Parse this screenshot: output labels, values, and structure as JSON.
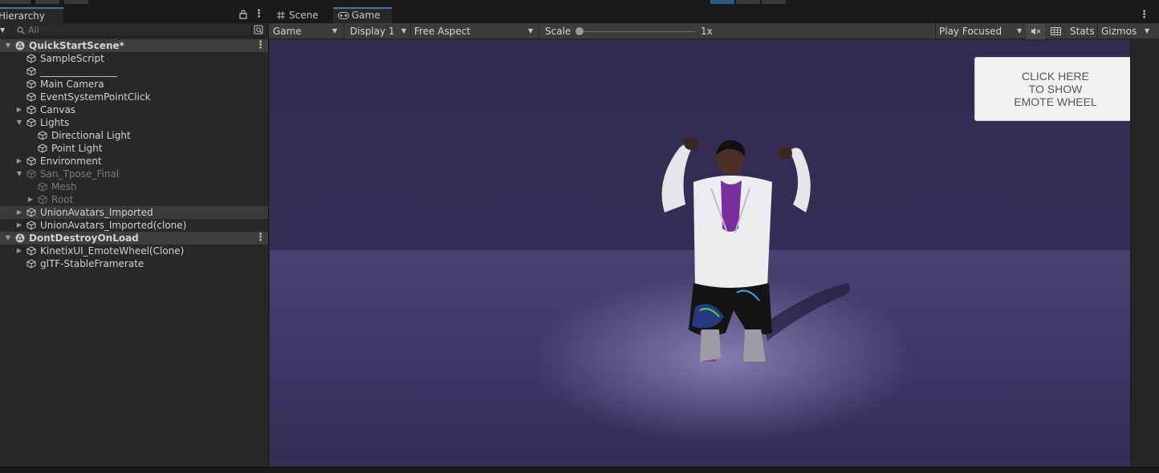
{
  "hierarchy": {
    "tab_label": "Hierarchy",
    "search_placeholder": "All",
    "items": [
      {
        "label": "QuickStartScene*",
        "type": "scene",
        "depth": 0,
        "expanded": true
      },
      {
        "label": "SampleScript",
        "type": "object",
        "depth": 1
      },
      {
        "label": "________________",
        "type": "object",
        "depth": 1
      },
      {
        "label": "Main Camera",
        "type": "object",
        "depth": 1
      },
      {
        "label": "EventSystemPointClick",
        "type": "object",
        "depth": 1
      },
      {
        "label": "Canvas",
        "type": "object",
        "depth": 1,
        "collapsed": true
      },
      {
        "label": "Lights",
        "type": "object",
        "depth": 1,
        "expanded": true
      },
      {
        "label": "Directional Light",
        "type": "object",
        "depth": 2
      },
      {
        "label": "Point Light",
        "type": "object",
        "depth": 2
      },
      {
        "label": "Environment",
        "type": "object",
        "depth": 1,
        "collapsed": true
      },
      {
        "label": "San_Tpose_Final",
        "type": "object",
        "depth": 1,
        "expanded": true,
        "inactive": true
      },
      {
        "label": "Mesh",
        "type": "object",
        "depth": 2,
        "inactive": true
      },
      {
        "label": "Root",
        "type": "object",
        "depth": 2,
        "collapsed": true,
        "inactive": true
      },
      {
        "label": "UnionAvatars_Imported",
        "type": "object",
        "depth": 1,
        "collapsed": true,
        "highlighted": true
      },
      {
        "label": "UnionAvatars_Imported(clone)",
        "type": "object",
        "depth": 1,
        "collapsed": true
      },
      {
        "label": "DontDestroyOnLoad",
        "type": "scene",
        "depth": 0,
        "expanded": true
      },
      {
        "label": "KinetixUI_EmoteWheel(Clone)",
        "type": "object",
        "depth": 1,
        "collapsed": true
      },
      {
        "label": "glTF-StableFramerate",
        "type": "object",
        "depth": 1
      }
    ]
  },
  "game_view": {
    "tabs": [
      {
        "label": "Scene",
        "icon": "grid-icon",
        "active": false
      },
      {
        "label": "Game",
        "icon": "gamepad-icon",
        "active": true
      }
    ],
    "toolbar": {
      "view_mode": "Game",
      "display": "Display 1",
      "aspect": "Free Aspect",
      "scale_label": "Scale",
      "scale_value": "1x",
      "scale_level": 0,
      "play_mode": "Play Focused",
      "stats_label": "Stats",
      "gizmos_label": "Gizmos"
    },
    "emote_button_text": "CLICK HERE\nTO SHOW\nEMOTE WHEEL"
  },
  "colors": {
    "panel_bg": "#282828",
    "tab_accent": "#3a79bb",
    "scene_row_bg": "#3e3e3e",
    "viewport_bg": "#3a325e",
    "button_bg": "#f2f2f2"
  }
}
